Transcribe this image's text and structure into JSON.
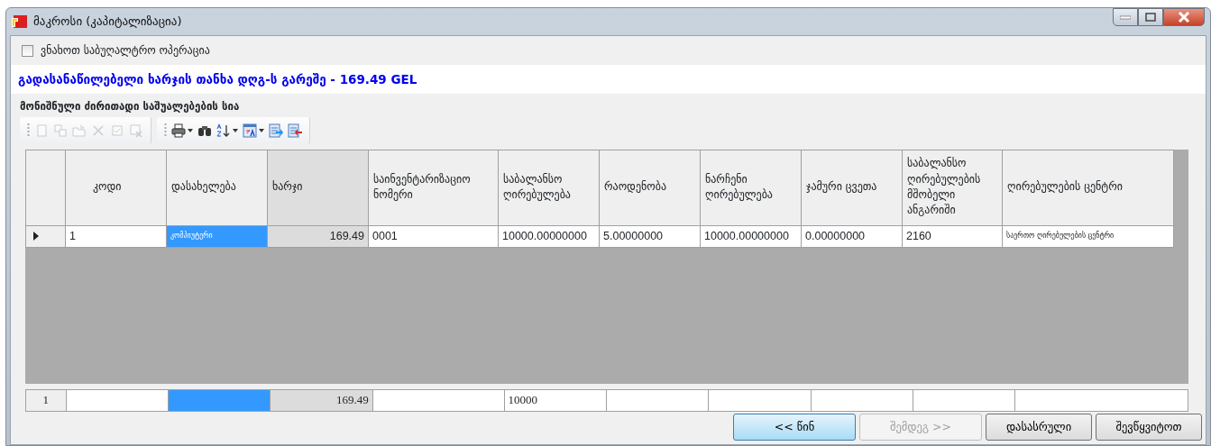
{
  "window": {
    "title": "მაკროსი (კაპიტალიზაცია)"
  },
  "show_operation": {
    "label": "ვნახოთ საბუღალტრო ოპერაცია",
    "checked": false
  },
  "summary": "გადასანაწილებელი ხარჯის თანხა დღგ-ს გარეშე - 169.49 GEL",
  "list_title": "მონიშნული ძირითადი საშუალებების სია",
  "toolbar": [
    {
      "kind": "new",
      "disabled": true
    },
    {
      "kind": "copy",
      "disabled": true
    },
    {
      "kind": "open",
      "disabled": true
    },
    {
      "kind": "delete",
      "disabled": true
    },
    {
      "kind": "check",
      "disabled": true
    },
    {
      "kind": "uncheck",
      "disabled": true
    },
    {
      "kind": "separator"
    },
    {
      "kind": "print",
      "disabled": false,
      "dropdown": true
    },
    {
      "kind": "find",
      "disabled": false
    },
    {
      "kind": "sort",
      "disabled": false,
      "dropdown": true
    },
    {
      "kind": "format",
      "disabled": false,
      "dropdown": true
    },
    {
      "kind": "export",
      "disabled": false
    },
    {
      "kind": "import",
      "disabled": false
    }
  ],
  "table": {
    "columns": [
      {
        "label": "კოდი",
        "readonly": false
      },
      {
        "label": "დასახელება",
        "readonly": false
      },
      {
        "label": "ხარჯი",
        "readonly": true
      },
      {
        "label": "საინვენტარიზაციო ნომერი",
        "readonly": false
      },
      {
        "label": "საბალანსო ღირებულება",
        "readonly": false
      },
      {
        "label": "რაოდენობა",
        "readonly": false
      },
      {
        "label": "ნარჩენი ღირებულება",
        "readonly": false
      },
      {
        "label": "ჯამური ცვეთა",
        "readonly": false
      },
      {
        "label": "საბალანსო ღირებულების მშობელი ანგარიში",
        "readonly": false
      },
      {
        "label": "ღირებულების ცენტრი",
        "readonly": false
      }
    ],
    "rows": [
      {
        "current": true,
        "cells": [
          {
            "value": "1",
            "selected": false
          },
          {
            "value": "კომპიუტერი",
            "selected": true,
            "small": true
          },
          {
            "value": "169.49",
            "selected": false,
            "right_aligned": true
          },
          {
            "value": "0001",
            "selected": false
          },
          {
            "value": "10000.00000000",
            "selected": false
          },
          {
            "value": "5.00000000",
            "selected": false
          },
          {
            "value": "10000.00000000",
            "selected": false
          },
          {
            "value": "0.00000000",
            "selected": false
          },
          {
            "value": "2160",
            "selected": false
          },
          {
            "value": "საერთო ღირებულების ცენტრი",
            "selected": false,
            "small": true
          }
        ]
      }
    ],
    "footer": {
      "label": "1",
      "cells": [
        {
          "selected": false
        },
        {
          "selected": true
        },
        {
          "value": "169.49",
          "selected": false,
          "right_aligned": true
        },
        {
          "selected": false
        },
        {
          "value": "10000",
          "selected": false
        },
        {
          "selected": false
        },
        {
          "selected": false
        },
        {
          "selected": false
        },
        {
          "selected": false
        },
        {
          "selected": false
        }
      ]
    }
  },
  "buttons": [
    {
      "label": "<< წინ",
      "default": true,
      "disabled": false
    },
    {
      "label": "შემდეგ >>",
      "default": false,
      "disabled": true
    },
    {
      "label": "დასასრული",
      "default": false,
      "disabled": false
    },
    {
      "label": "შევწყვიტოთ",
      "default": false,
      "disabled": false
    }
  ]
}
